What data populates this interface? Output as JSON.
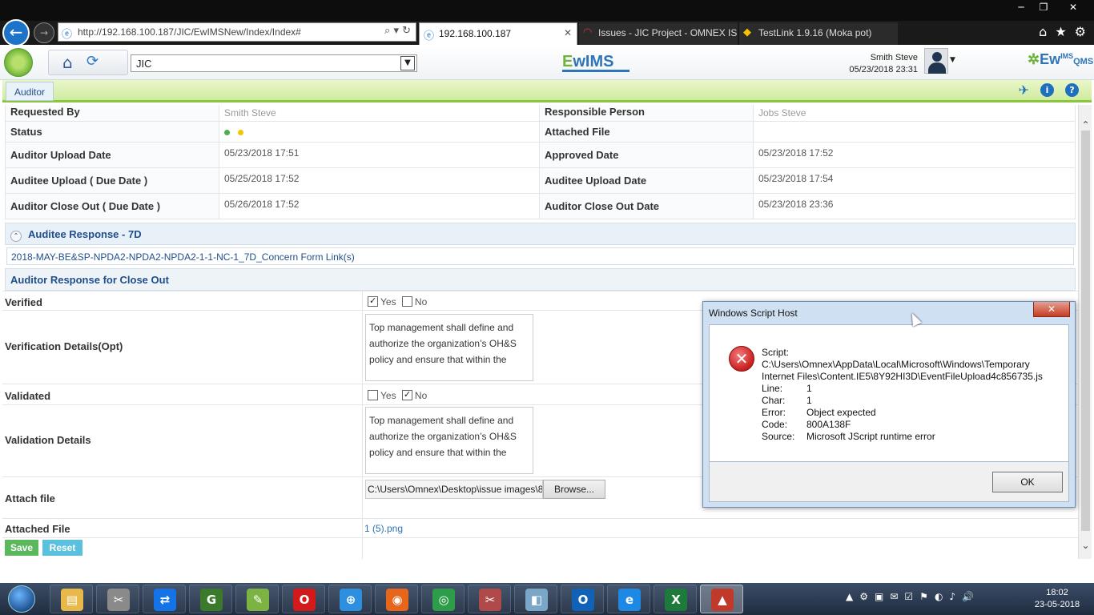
{
  "browser": {
    "url": "http://192.168.100.187/JIC/EwIMSNew/Index/Index#",
    "tabs": [
      {
        "label": "192.168.100.187",
        "active": true
      },
      {
        "label": "Issues - JIC Project - OMNEX IS...",
        "active": false
      },
      {
        "label": "TestLink 1.9.16 (Moka pot)",
        "active": false
      }
    ],
    "window_buttons": {
      "minimize": "─",
      "maximize": "❐",
      "close": "✕"
    }
  },
  "header": {
    "site_select_value": "JIC",
    "brand_center_e": "E",
    "brand_center_rest": "wIMS",
    "brand_right_main": "Ew",
    "brand_right_sup": "IMS",
    "brand_right_qms": "QMS",
    "user_name": "Smith Steve",
    "user_datetime": "05/23/2018 23:31"
  },
  "module": {
    "tab_label": "Auditor",
    "icons": [
      "pin-icon",
      "info-icon",
      "help-icon"
    ]
  },
  "details": {
    "rows": [
      {
        "l1": "Requested By",
        "v1": "Smith Steve",
        "l2": "Responsible Person",
        "v2": "Jobs Steve"
      },
      {
        "l1": "Status",
        "v1": "",
        "l2": "Attached File",
        "v2": ""
      },
      {
        "l1": "Auditor Upload Date",
        "v1": "05/23/2018 17:51",
        "l2": "Approved Date",
        "v2": "05/23/2018 17:52"
      },
      {
        "l1": "Auditee Upload ( Due Date )",
        "v1": "05/25/2018 17:52",
        "l2": "Auditee Upload Date",
        "v2": "05/23/2018 17:54"
      },
      {
        "l1": "Auditor Close Out ( Due Date )",
        "v1": "05/26/2018 17:52",
        "l2": "Auditor Close Out Date",
        "v2": "05/23/2018 23:36"
      }
    ],
    "status_colors": [
      "#4caf50",
      "#f5c400"
    ]
  },
  "auditee_response": {
    "title": "Auditee Response - 7D",
    "link": "2018-MAY-BE&SP-NPDA2-NPDA2-NPDA2-1-1-NC-1_7D_Concern Form Link(s)"
  },
  "closeout": {
    "title": "Auditor Response for Close Out",
    "verified_label": "Verified",
    "yes": "Yes",
    "no": "No",
    "verified_yes": true,
    "verification_details_label": "Verification Details(Opt)",
    "verification_details_text": "Top management shall define and authorize the organization’s OH&S policy and ensure that within the",
    "validated_label": "Validated",
    "validated_no": true,
    "validation_details_label": "Validation Details",
    "validation_details_text": "Top management shall define and authorize the organization’s OH&S policy and ensure that within the",
    "attach_file_label": "Attach file",
    "attach_file_value": "C:\\Users\\Omnex\\Desktop\\issue images\\8I",
    "browse_label": "Browse...",
    "attached_file_label": "Attached File",
    "attached_file_link": "1 (5).png",
    "save_label": "Save",
    "reset_label": "Reset"
  },
  "dialog": {
    "title": "Windows Script Host",
    "script_label": "Script:",
    "script_path_1": "C:\\Users\\Omnex\\AppData\\Local\\Microsoft\\Windows\\Temporary",
    "script_path_2": "Internet Files\\Content.IE5\\8Y92HI3D\\EventFileUpload4c856735.js",
    "line_label": "Line:",
    "line_value": "1",
    "char_label": "Char:",
    "char_value": "1",
    "error_label": "Error:",
    "error_value": "Object expected",
    "code_label": "Code:",
    "code_value": "800A138F",
    "source_label": "Source:",
    "source_value": "Microsoft JScript runtime error",
    "ok_label": "OK"
  },
  "taskbar": {
    "items": [
      {
        "icon": "file-explorer-icon",
        "color": "#e8b84a",
        "glyph": "▤"
      },
      {
        "icon": "tools-icon",
        "color": "#8a8a8a",
        "glyph": "✂"
      },
      {
        "icon": "teamviewer-icon",
        "color": "#1473e6",
        "glyph": "⇄"
      },
      {
        "icon": "greenshot-icon",
        "color": "#3a7a2a",
        "glyph": "G"
      },
      {
        "icon": "notepad-plus-icon",
        "color": "#7cb342",
        "glyph": "✎"
      },
      {
        "icon": "opera-icon",
        "color": "#d31a1a",
        "glyph": "O"
      },
      {
        "icon": "safari-icon",
        "color": "#2c8fe0",
        "glyph": "⊕"
      },
      {
        "icon": "firefox-icon",
        "color": "#e8661c",
        "glyph": "◉"
      },
      {
        "icon": "chrome-icon",
        "color": "#2e9d4a",
        "glyph": "◎"
      },
      {
        "icon": "snipping-tool-icon",
        "color": "#b04a4a",
        "glyph": "✂"
      },
      {
        "icon": "notes-icon",
        "color": "#7aa6c8",
        "glyph": "◧"
      },
      {
        "icon": "outlook-icon",
        "color": "#0f62b8",
        "glyph": "O"
      },
      {
        "icon": "internet-explorer-icon",
        "color": "#1e88e5",
        "glyph": "e"
      },
      {
        "icon": "excel-icon",
        "color": "#1d7a3a",
        "glyph": "X"
      },
      {
        "icon": "paint-icon",
        "color": "#c0392b",
        "glyph": "▲"
      }
    ],
    "tray_icons": [
      "▲",
      "⚙",
      "▣",
      "✉",
      "☑",
      "⚑",
      "◐",
      "♪",
      "🔊"
    ],
    "time": "18:02",
    "date": "23-05-2018"
  }
}
